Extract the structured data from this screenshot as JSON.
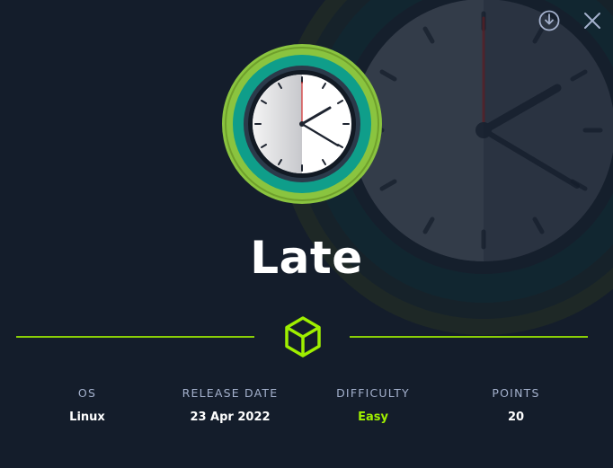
{
  "machine": {
    "name": "Late"
  },
  "stats": {
    "os": {
      "label": "OS",
      "value": "Linux"
    },
    "release_date": {
      "label": "RELEASE DATE",
      "value": "23 Apr 2022"
    },
    "difficulty": {
      "label": "DIFFICULTY",
      "value": "Easy"
    },
    "points": {
      "label": "POINTS",
      "value": "20"
    }
  },
  "icons": {
    "download": "download-icon",
    "close": "close-icon",
    "logo": "clock-icon",
    "cube": "cube-icon"
  },
  "colors": {
    "background": "#141d2b",
    "accent": "#9fef00",
    "label": "#a4b1cd",
    "ring_outer": "#8ac43f",
    "ring_inner": "#0f9e8a"
  }
}
